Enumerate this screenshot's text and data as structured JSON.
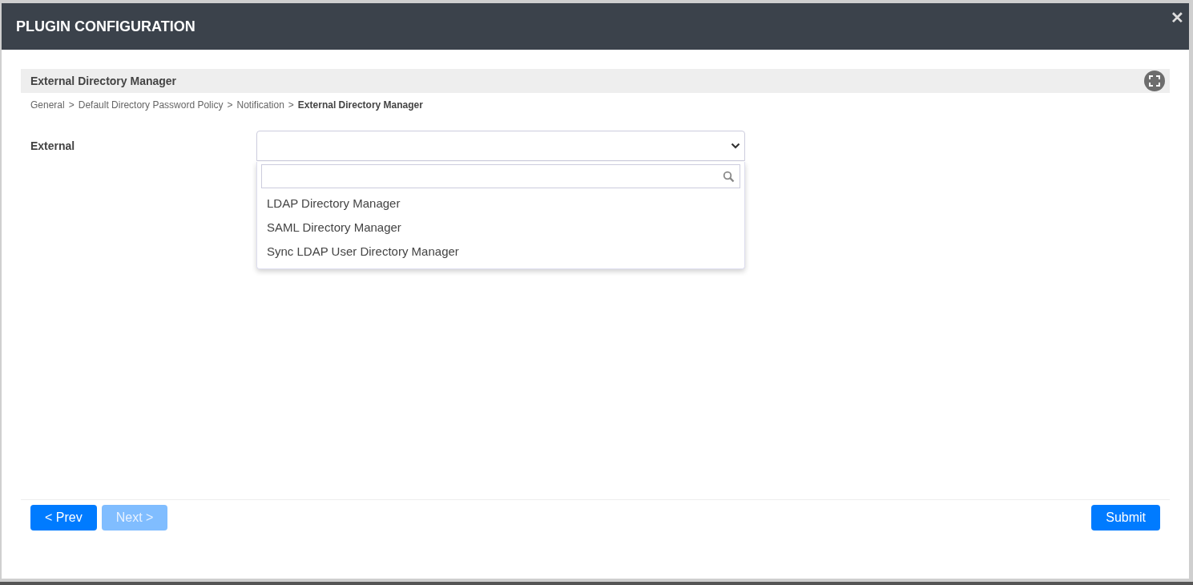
{
  "dialog": {
    "title": "PLUGIN CONFIGURATION",
    "close": "✕"
  },
  "section": {
    "title": "External Directory Manager"
  },
  "breadcrumb": [
    {
      "kind": "crumb",
      "label": "General"
    },
    {
      "kind": "separator",
      "label": ">"
    },
    {
      "kind": "crumb",
      "label": "Default Directory Password Policy"
    },
    {
      "kind": "separator",
      "label": ">"
    },
    {
      "kind": "crumb",
      "label": "Notification"
    },
    {
      "kind": "separator",
      "label": ">"
    },
    {
      "kind": "current",
      "label": "External Directory Manager"
    }
  ],
  "field": {
    "label": "External",
    "expanded": true,
    "options": [
      {
        "label": "LDAP Directory Manager"
      },
      {
        "label": "SAML Directory Manager"
      },
      {
        "label": "Sync LDAP User Directory Manager"
      }
    ]
  },
  "buttons": [
    {
      "label": "< Prev",
      "disabled": false
    },
    {
      "label": "Next >",
      "disabled": true
    }
  ],
  "submit": {
    "label": "Submit",
    "disabled": false
  }
}
